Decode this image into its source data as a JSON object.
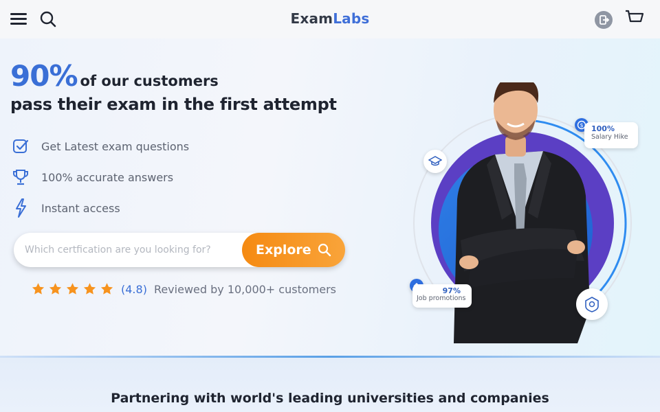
{
  "header": {
    "logo_part1": "Exam",
    "logo_part2": "Labs",
    "icons": [
      "hamburger-menu-icon",
      "search-icon",
      "logout-icon",
      "cart-icon"
    ]
  },
  "hero": {
    "big_stat": "90%",
    "headline_rest": "of our customers",
    "headline_line2": "pass their exam in the first attempt",
    "features": [
      {
        "icon": "checkbox-icon",
        "text": "Get Latest exam questions"
      },
      {
        "icon": "trophy-icon",
        "text": "100% accurate answers"
      },
      {
        "icon": "lightning-icon",
        "text": "Instant access"
      }
    ],
    "search": {
      "placeholder": "Which certfication are you looking for?",
      "value": "",
      "button_label": "Explore"
    },
    "rating": {
      "stars": 5,
      "value": "(4.8)",
      "reviews_text": "Reviewed by 10,000+ customers"
    },
    "illustration": {
      "salary_badge_value": "100%",
      "salary_badge_label": "Salary Hike",
      "promotion_badge_value": "97%",
      "promotion_badge_label": "Job promotions"
    }
  },
  "partners": {
    "title": "Partnering with world's leading universities and companies"
  },
  "colors": {
    "accent_blue": "#3a6fd6",
    "orange": "#f58a12",
    "purple_ring": "#5b3fc4"
  }
}
